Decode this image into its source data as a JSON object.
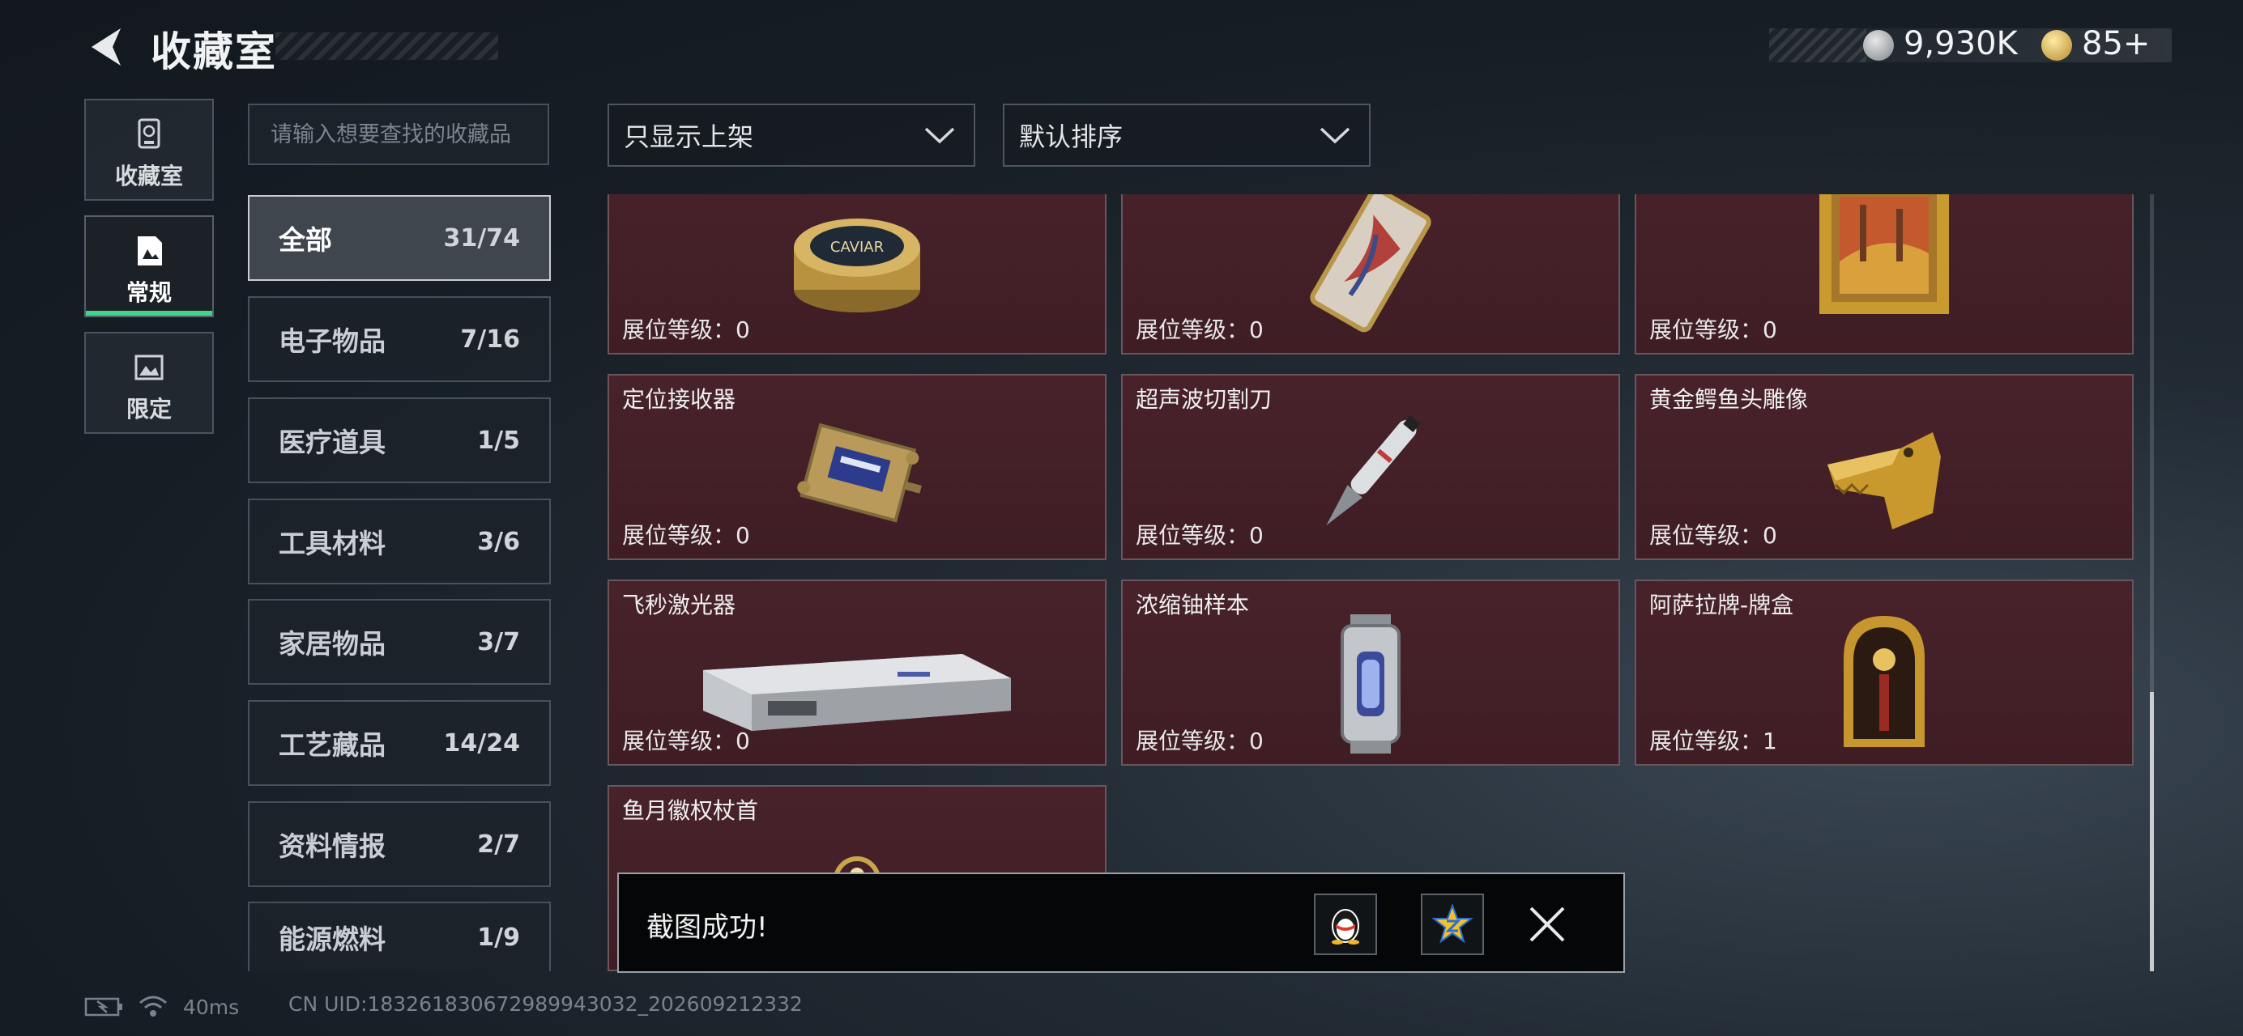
{
  "header": {
    "title": "收藏室",
    "currency": [
      {
        "icon": "silver-coin-icon",
        "value": "9,930K"
      },
      {
        "icon": "gold-coin-icon",
        "value": "85+"
      }
    ]
  },
  "side_tabs": [
    {
      "label": "收藏室",
      "icon": "trophy-box-icon",
      "active": false
    },
    {
      "label": "常规",
      "icon": "document-icon",
      "active": true
    },
    {
      "label": "限定",
      "icon": "image-frame-icon",
      "active": false
    }
  ],
  "search": {
    "placeholder": "请输入想要查找的收藏品"
  },
  "categories": [
    {
      "name": "全部",
      "count": "31/74",
      "active": true
    },
    {
      "name": "电子物品",
      "count": "7/16"
    },
    {
      "name": "医疗道具",
      "count": "1/5"
    },
    {
      "name": "工具材料",
      "count": "3/6"
    },
    {
      "name": "家居物品",
      "count": "3/7"
    },
    {
      "name": "工艺藏品",
      "count": "14/24"
    },
    {
      "name": "资料情报",
      "count": "2/7"
    },
    {
      "name": "能源燃料",
      "count": "1/9"
    }
  ],
  "filters": {
    "shelf_filter": "只显示上架",
    "sort": "默认排序"
  },
  "items": [
    {
      "name": "",
      "level_label": "展位等级：",
      "level": "0",
      "art": "caviar-tin",
      "art_text": "CAVIAR"
    },
    {
      "name": "",
      "level_label": "展位等级：",
      "level": "0",
      "art": "gilded-card"
    },
    {
      "name": "",
      "level_label": "展位等级：",
      "level": "0",
      "art": "framed-painting"
    },
    {
      "name": "定位接收器",
      "level_label": "展位等级：",
      "level": "0",
      "art": "gps-receiver"
    },
    {
      "name": "超声波切割刀",
      "level_label": "展位等级：",
      "level": "0",
      "art": "ultrasonic-cutter"
    },
    {
      "name": "黄金鳄鱼头雕像",
      "level_label": "展位等级：",
      "level": "0",
      "art": "gold-crocodile-head"
    },
    {
      "name": "飞秒激光器",
      "level_label": "展位等级：",
      "level": "0",
      "art": "femtosecond-laser"
    },
    {
      "name": "浓缩铀样本",
      "level_label": "展位等级：",
      "level": "0",
      "art": "uranium-canister"
    },
    {
      "name": "阿萨拉牌-牌盒",
      "level_label": "展位等级：",
      "level": "1",
      "art": "card-box"
    },
    {
      "name": "鱼月徽权杖首",
      "level_label": "",
      "level": "",
      "art": "scepter-head"
    }
  ],
  "toast": {
    "message": "截图成功!"
  },
  "status": {
    "ping": "40ms",
    "uid": "CN UID:183261830672989943032_202609212332"
  },
  "colors": {
    "card_bg": "#45202a",
    "accent_green": "#3fd58a",
    "card_border": "#6b5559"
  }
}
